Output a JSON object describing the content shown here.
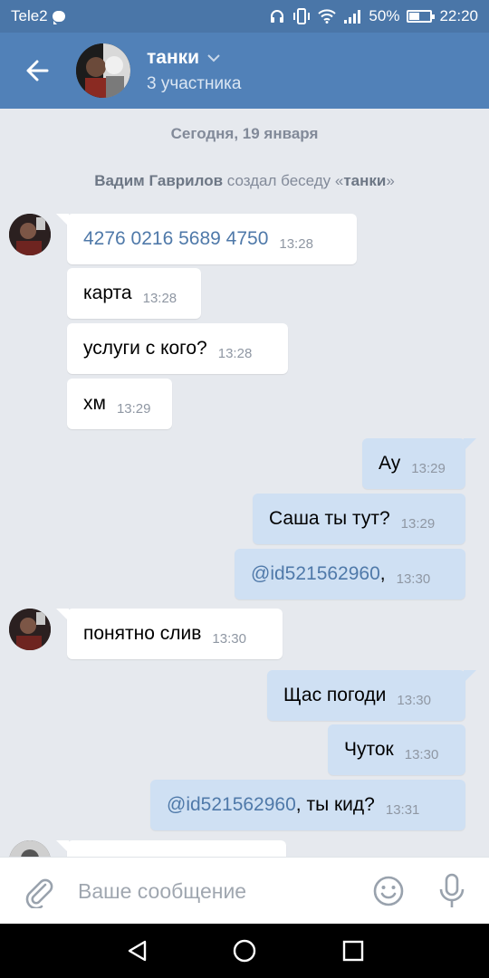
{
  "status_bar": {
    "carrier": "Tele2",
    "battery": "50%",
    "battery_level": 0.5,
    "time": "22:20"
  },
  "header": {
    "back_icon": "arrow-left-icon",
    "title": "танки",
    "subtitle": "3 участника",
    "dropdown_icon": "chevron-down-icon"
  },
  "feed": {
    "date": "Сегодня, 19 января",
    "service": {
      "author": "Вадим Гаврилов",
      "action": " создал беседу «",
      "chat": "танки",
      "close": "»"
    },
    "messages": [
      {
        "dir": "in",
        "text": "4276 0216 5689 4750",
        "time": "13:28"
      },
      {
        "dir": "in",
        "text": "карта",
        "time": "13:28"
      },
      {
        "dir": "in",
        "text": "услуги с кого?",
        "time": "13:28"
      },
      {
        "dir": "in",
        "text": "хм",
        "time": "13:29"
      },
      {
        "dir": "out",
        "text": "Ау",
        "time": "13:29"
      },
      {
        "dir": "out",
        "text": "Саша ты тут?",
        "time": "13:29"
      },
      {
        "dir": "out",
        "mention": "@id521562960",
        "text": ",",
        "time": "13:30"
      },
      {
        "dir": "in",
        "text": "понятно слив",
        "time": "13:30"
      },
      {
        "dir": "out",
        "text": "Щас погоди",
        "time": "13:30"
      },
      {
        "dir": "out",
        "text": "Чуток",
        "time": "13:30"
      },
      {
        "dir": "out",
        "mention": "@id521562960",
        "text": ", ты кид?",
        "time": "13:31"
      }
    ]
  },
  "input": {
    "placeholder": "Ваше сообщение",
    "value": ""
  },
  "colors": {
    "header": "#5181b8",
    "status_bar": "#4a76a8",
    "background": "#e6e9ee",
    "incoming": "#ffffff",
    "outgoing": "#cfe0f3",
    "link": "#4f79a9"
  }
}
